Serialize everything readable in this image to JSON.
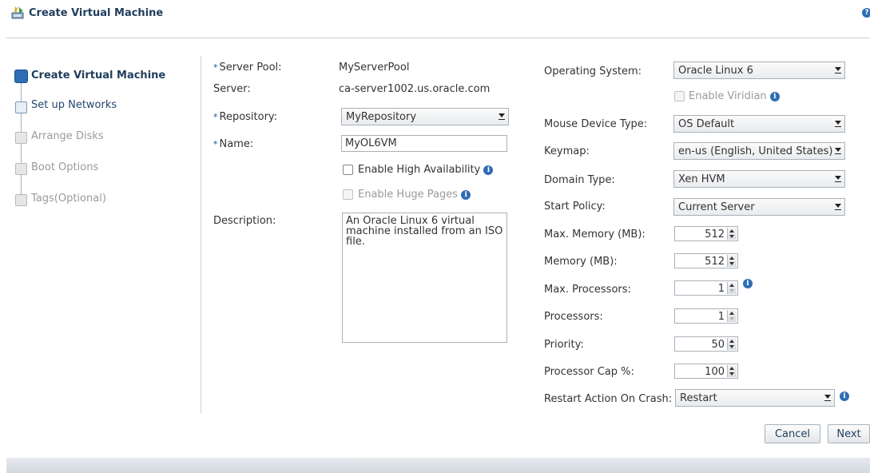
{
  "header": {
    "title": "Create Virtual Machine",
    "help": "?"
  },
  "train": [
    {
      "label": "Create Virtual Machine",
      "state": "active"
    },
    {
      "label": "Set up Networks",
      "state": "next"
    },
    {
      "label": "Arrange Disks",
      "state": "off"
    },
    {
      "label": "Boot Options",
      "state": "off"
    },
    {
      "label": "Tags(Optional)",
      "state": "off"
    }
  ],
  "form_left": {
    "required_marker": "*",
    "server_pool_label": "Server Pool:",
    "server_pool_value": "MyServerPool",
    "server_label": "Server:",
    "server_value": "ca-server1002.us.oracle.com",
    "repository_label": "Repository:",
    "repository_value": "MyRepository",
    "name_label": "Name:",
    "name_value": "MyOL6VM",
    "ha_label": "Enable High Availability",
    "huge_pages_label": "Enable Huge Pages",
    "description_label": "Description:",
    "description_value": "An Oracle Linux 6 virtual machine installed from an ISO file."
  },
  "form_right": {
    "os_label": "Operating System:",
    "os_value": "Oracle Linux 6",
    "viridian_label": "Enable Viridian",
    "mouse_label": "Mouse Device Type:",
    "mouse_value": "OS Default",
    "keymap_label": "Keymap:",
    "keymap_value": "en-us (English, United States)",
    "domain_label": "Domain Type:",
    "domain_value": "Xen HVM",
    "start_policy_label": "Start Policy:",
    "start_policy_value": "Current Server",
    "max_mem_label": "Max. Memory (MB):",
    "max_mem_value": "512",
    "mem_label": "Memory (MB):",
    "mem_value": "512",
    "max_proc_label": "Max. Processors:",
    "max_proc_value": "1",
    "proc_label": "Processors:",
    "proc_value": "1",
    "priority_label": "Priority:",
    "priority_value": "50",
    "cap_label": "Processor Cap %:",
    "cap_value": "100",
    "restart_label": "Restart Action On Crash:",
    "restart_value": "Restart"
  },
  "buttons": {
    "cancel": "Cancel",
    "next": "Next"
  },
  "colors": {
    "accent": "#2f6db5",
    "title": "#1f3d5c"
  }
}
